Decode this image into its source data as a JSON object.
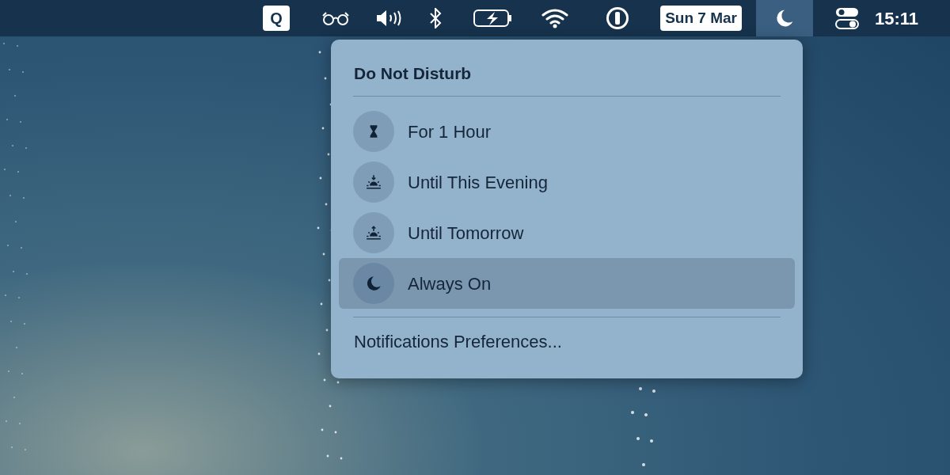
{
  "menu_bar": {
    "app_letter": "Q",
    "date": "Sun 7 Mar",
    "dnd_selected": true,
    "time": "15:11"
  },
  "menu": {
    "title": "Do Not Disturb",
    "options": [
      {
        "kind": "hourglass",
        "label": "For 1 Hour",
        "selected": false
      },
      {
        "kind": "sunset",
        "label": "Until This Evening",
        "selected": false
      },
      {
        "kind": "sunrise",
        "label": "Until Tomorrow",
        "selected": false
      },
      {
        "kind": "moon",
        "label": "Always On",
        "selected": true
      }
    ],
    "footer": "Notifications Preferences..."
  }
}
